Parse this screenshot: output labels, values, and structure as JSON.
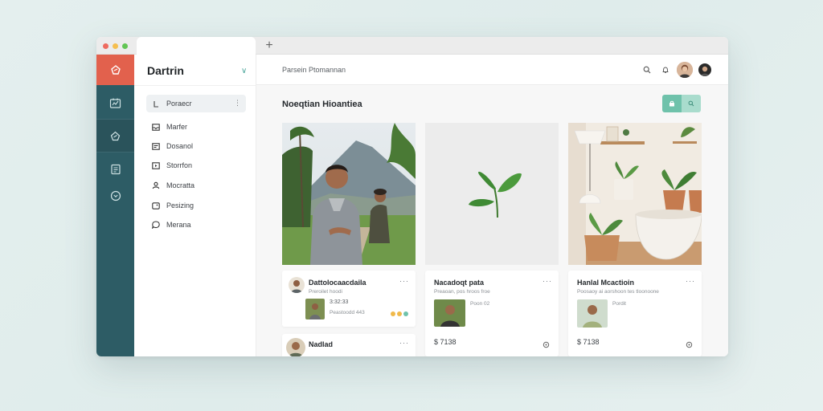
{
  "window": {
    "brand": "Dartrin",
    "breadcrumb": "Parsein Ptomannan"
  },
  "sidebar": {
    "items": [
      {
        "label": "Poraecr",
        "icon": "bracket-icon",
        "active": true
      },
      {
        "label": "Marfer",
        "icon": "inbox-icon"
      },
      {
        "label": "Dosanol",
        "icon": "calendar-icon"
      },
      {
        "label": "Storrfon",
        "icon": "play-box-icon"
      },
      {
        "label": "Mocratta",
        "icon": "user-icon"
      },
      {
        "label": "Pesizing",
        "icon": "tag-icon"
      },
      {
        "label": "Merana",
        "icon": "chat-icon"
      }
    ]
  },
  "main": {
    "title": "Noeqtian Hioantiea",
    "posts": [
      {
        "title": "Dattolocaacdaila",
        "sub": "Preroilet hoodi",
        "stat": "3:32:33",
        "stat2": "Peastoodd 443",
        "price": null
      },
      {
        "title": "Nacadoqt pata",
        "sub": "Preaoan, pos hroos froe",
        "stat": "Poon 02",
        "stat2": null,
        "price": "$ 7138"
      },
      {
        "title": "Hanlal Mcactioin",
        "sub": "Poosaoy ai aorshoon tes tloonoone",
        "stat": "Pordit",
        "stat2": null,
        "price": "$ 7138"
      },
      {
        "title": "Nadlad",
        "sub": "",
        "stat": null,
        "stat2": null,
        "price": null
      }
    ]
  },
  "colors": {
    "rail": "#2d5c65",
    "accent_red": "#e2614d",
    "accent_green": "#6fc2ab"
  }
}
